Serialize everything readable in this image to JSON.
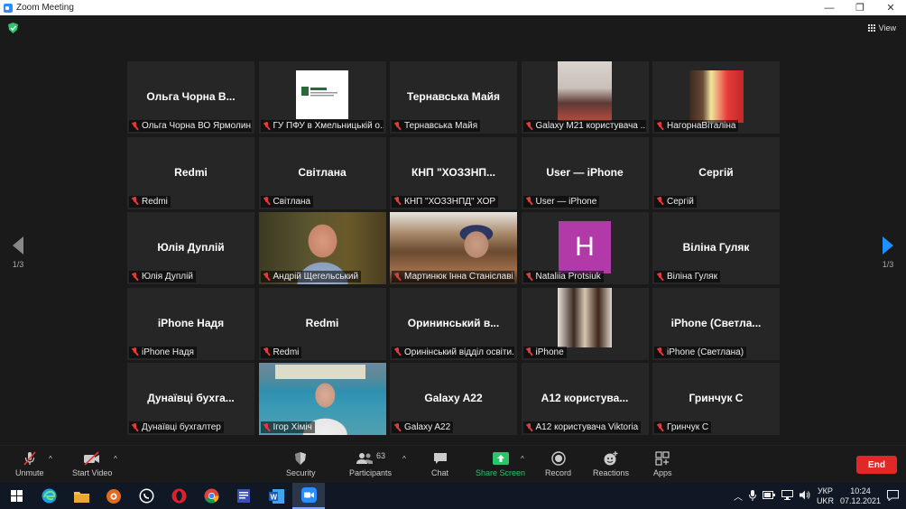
{
  "window": {
    "title": "Zoom Meeting",
    "minimize": "—",
    "maximize": "❐",
    "close": "✕"
  },
  "view_label": "View",
  "pager": {
    "left": "1/3",
    "right": "1/3"
  },
  "tiles": [
    {
      "kind": "name",
      "big": "Ольга Чорна В...",
      "label": "Ольга Чорна ВО Ярмолин..."
    },
    {
      "kind": "logo",
      "big": "",
      "label": "ГУ ПФУ в Хмельницькій о..."
    },
    {
      "kind": "name",
      "big": "Тернавська Майя",
      "label": "Тернавська Майя"
    },
    {
      "kind": "photo1",
      "big": "",
      "label": "Galaxy M21 користувача ..."
    },
    {
      "kind": "photo2",
      "big": "",
      "label": "НагорнаВіталіна"
    },
    {
      "kind": "name",
      "big": "Redmi",
      "label": "Redmi"
    },
    {
      "kind": "name",
      "big": "Світлана",
      "label": "Світлана"
    },
    {
      "kind": "name",
      "big": "КНП  \"ХОЗЗНП...",
      "label": "КНП \"ХОЗЗНПД\" ХОР"
    },
    {
      "kind": "name",
      "big": "User — iPhone",
      "label": "User — iPhone"
    },
    {
      "kind": "name",
      "big": "Сергій",
      "label": "Сергій"
    },
    {
      "kind": "name",
      "big": "Юлія Дуплій",
      "label": "Юлія Дуплій"
    },
    {
      "kind": "video1",
      "big": "",
      "label": "Андрій Щегельський"
    },
    {
      "kind": "video2",
      "big": "",
      "label": "Мартинюк Інна Станіславі..."
    },
    {
      "kind": "avatar",
      "big": "H",
      "label": "Nataliia Protsiuk"
    },
    {
      "kind": "name",
      "big": "Віліна Гуляк",
      "label": "Віліна Гуляк"
    },
    {
      "kind": "name",
      "big": "iPhone Надя",
      "label": "iPhone Надя"
    },
    {
      "kind": "name",
      "big": "Redmi",
      "label": "Redmi"
    },
    {
      "kind": "name",
      "big": "Орининський  в...",
      "label": "Оринінський відділ освіти..."
    },
    {
      "kind": "photo3",
      "big": "",
      "label": "iPhone"
    },
    {
      "kind": "name",
      "big": "iPhone  (Светла...",
      "label": "iPhone (Светлана)"
    },
    {
      "kind": "name",
      "big": "Дунаївці бухга...",
      "label": "Дунаївці бухгалтер"
    },
    {
      "kind": "video3",
      "big": "",
      "label": "Ігор Хіміч"
    },
    {
      "kind": "name",
      "big": "Galaxy A22",
      "label": "Galaxy A22"
    },
    {
      "kind": "name",
      "big": "A12  користува...",
      "label": "A12 користувача Viktoria"
    },
    {
      "kind": "name",
      "big": "Гринчук С",
      "label": "Гринчук С"
    }
  ],
  "toolbar": {
    "unmute": "Unmute",
    "start_video": "Start Video",
    "security": "Security",
    "participants": "Participants",
    "participants_count": "63",
    "chat": "Chat",
    "share_screen": "Share Screen",
    "record": "Record",
    "reactions": "Reactions",
    "apps": "Apps",
    "end": "End"
  },
  "taskbar": {
    "lang_top": "УКР",
    "lang_bottom": "UKR",
    "time": "10:24",
    "date": "07.12.2021"
  },
  "colors": {
    "accent_blue": "#1e90ff",
    "active_speaker": "#e5e34b",
    "end_red": "#e02828",
    "share_green": "#2ec46b",
    "avatar": "#b23aa8"
  }
}
